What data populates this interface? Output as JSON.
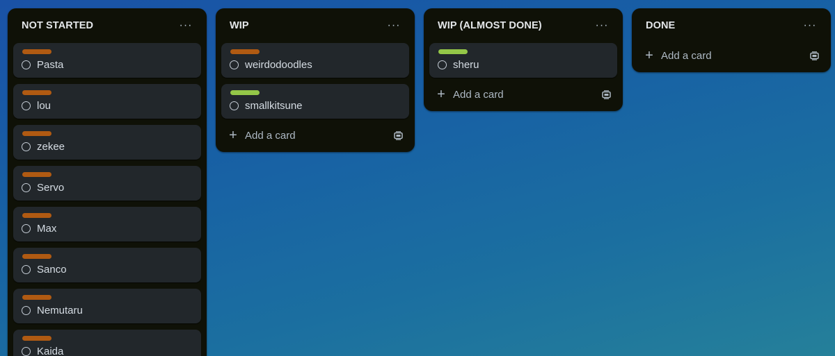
{
  "colors": {
    "orange_label": "#b05a12",
    "green_label": "#94c748"
  },
  "lists": [
    {
      "title": "NOT STARTED",
      "menu": "···",
      "cards": [
        {
          "label_color": "#b05a12",
          "title": "Pasta"
        },
        {
          "label_color": "#b05a12",
          "title": "lou"
        },
        {
          "label_color": "#b05a12",
          "title": "zekee"
        },
        {
          "label_color": "#b05a12",
          "title": "Servo"
        },
        {
          "label_color": "#b05a12",
          "title": "Max"
        },
        {
          "label_color": "#b05a12",
          "title": "Sanco"
        },
        {
          "label_color": "#b05a12",
          "title": "Nemutaru"
        },
        {
          "label_color": "#b05a12",
          "title": "Kaida"
        }
      ]
    },
    {
      "title": "WIP",
      "menu": "···",
      "cards": [
        {
          "label_color": "#b05a12",
          "title": "weirdodoodles"
        },
        {
          "label_color": "#94c748",
          "title": "smallkitsune"
        }
      ],
      "add_card": "Add a card"
    },
    {
      "title": "WIP (ALMOST DONE)",
      "menu": "···",
      "cards": [
        {
          "label_color": "#94c748",
          "title": "sheru"
        }
      ],
      "add_card": "Add a card"
    },
    {
      "title": "DONE",
      "menu": "···",
      "cards": [],
      "add_card": "Add a card"
    }
  ],
  "icons": {
    "plus": "+",
    "template": "template-icon",
    "circle": "complete-circle-icon",
    "menu": "more-icon"
  }
}
